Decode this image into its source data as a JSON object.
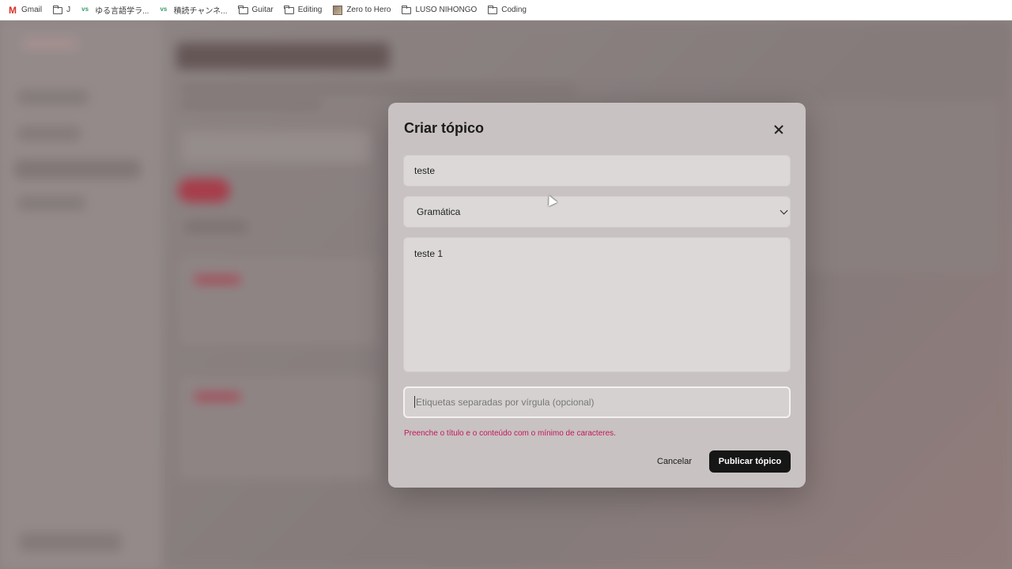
{
  "bookmarks": [
    {
      "label": "Gmail",
      "icon": "gmail-icon"
    },
    {
      "label": "J",
      "icon": "folder-icon"
    },
    {
      "label": "ゆる言語学ラ...",
      "icon": "vs-icon"
    },
    {
      "label": "積読チャンネ...",
      "icon": "vs-icon"
    },
    {
      "label": "Guitar",
      "icon": "folder-icon"
    },
    {
      "label": "Editing",
      "icon": "folder-icon"
    },
    {
      "label": "Zero to Hero",
      "icon": "image-icon"
    },
    {
      "label": "LUSO NIHONGO",
      "icon": "folder-icon"
    },
    {
      "label": "Coding",
      "icon": "folder-icon"
    }
  ],
  "modal": {
    "title": "Criar tópico",
    "title_value": "teste",
    "category_selected": "Gramática",
    "content_value": "teste 1",
    "tags_placeholder": "Etiquetas separadas por vírgula (opcional)",
    "error": "Preenche o título e o conteúdo com o mínimo de caracteres.",
    "cancel_label": "Cancelar",
    "publish_label": "Publicar tópico"
  },
  "colors": {
    "accent_error": "#c2185b",
    "primary_button": "#161616"
  }
}
